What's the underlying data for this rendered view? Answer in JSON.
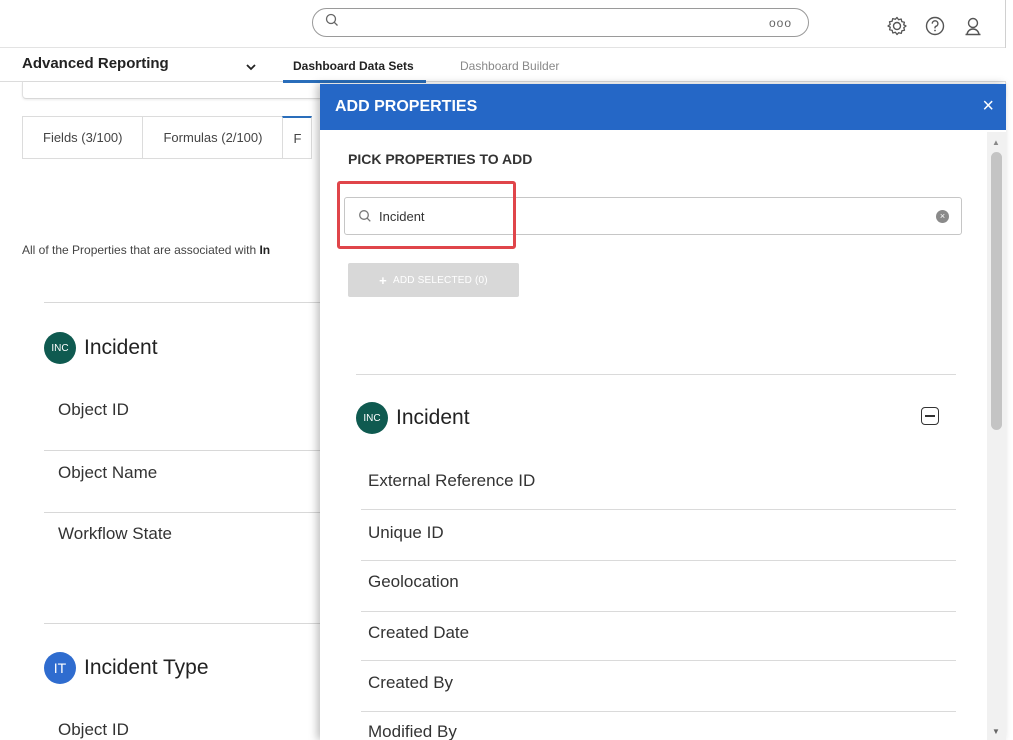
{
  "topbar": {
    "search_icon": "search-icon",
    "overflow_label": "ooo",
    "icons": [
      "gear-icon",
      "help-icon",
      "user-icon"
    ]
  },
  "nav": {
    "app_title": "Advanced Reporting",
    "tabs": [
      {
        "label": "Dashboard Data Sets",
        "active": true
      },
      {
        "label": "Dashboard Builder",
        "active": false
      }
    ]
  },
  "background": {
    "tabs": [
      "Fields (3/100)",
      "Formulas (2/100)",
      "F"
    ],
    "description_prefix": "All of the Properties that are associated with ",
    "description_bold": "In",
    "objects": [
      {
        "badge": "INC",
        "name": "Incident",
        "rows": [
          "Object ID",
          "Object Name",
          "Workflow State"
        ]
      },
      {
        "badge": "IT",
        "name": "Incident Type",
        "rows": [
          "Object ID"
        ]
      }
    ]
  },
  "modal": {
    "title": "ADD PROPERTIES",
    "close_label": "×",
    "section_heading": "PICK PROPERTIES TO ADD",
    "search": {
      "value": "Incident",
      "placeholder": "Search"
    },
    "add_button_label": "ADD SELECTED (0)",
    "object": {
      "badge": "INC",
      "name": "Incident",
      "properties": [
        "External Reference ID",
        "Unique ID",
        "Geolocation",
        "Created Date",
        "Created By",
        "Modified By"
      ]
    }
  },
  "colors": {
    "header_blue": "#2567c6",
    "highlight_red": "#e0454a",
    "inc_badge": "#0f5a50",
    "it_badge": "#2f6ccf"
  }
}
